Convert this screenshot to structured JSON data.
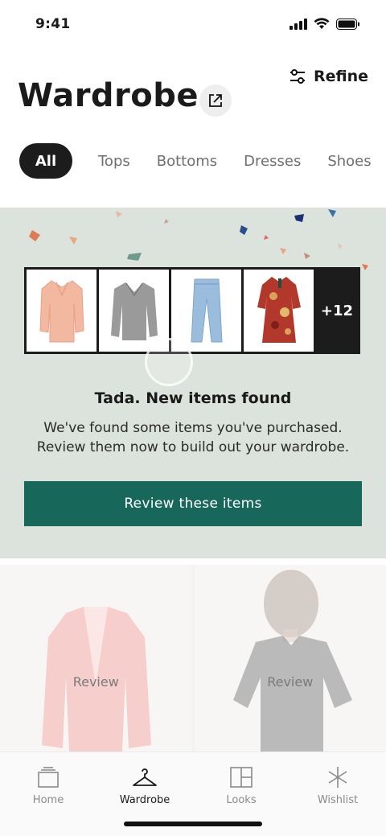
{
  "status": {
    "time": "9:41"
  },
  "header": {
    "title": "Wardrobe",
    "refine_label": "Refine"
  },
  "tabs": [
    {
      "label": "All",
      "active": true
    },
    {
      "label": "Tops"
    },
    {
      "label": "Bottoms"
    },
    {
      "label": "Dresses"
    },
    {
      "label": "Shoes"
    }
  ],
  "banner": {
    "more_count": "+12",
    "title": "Tada. New items found",
    "body_line1": "We've found some items you've purchased.",
    "body_line2": "Review them now to build out your wardrobe.",
    "cta": "Review these items",
    "thumbnails": [
      "blouse-image",
      "sweater-image",
      "jeans-image",
      "dress-image"
    ]
  },
  "grid": {
    "items": [
      {
        "label": "Review",
        "image": "pink-blazer-image"
      },
      {
        "label": "Review",
        "image": "model-tshirt-image"
      }
    ]
  },
  "nav": {
    "items": [
      {
        "label": "Home",
        "icon": "home-icon"
      },
      {
        "label": "Wardrobe",
        "icon": "hanger-icon",
        "active": true
      },
      {
        "label": "Looks",
        "icon": "looks-icon"
      },
      {
        "label": "Wishlist",
        "icon": "sparkle-icon"
      }
    ]
  },
  "colors": {
    "accent": "#17685a",
    "banner_bg": "#dce3dd",
    "dark": "#1c1c1c"
  }
}
